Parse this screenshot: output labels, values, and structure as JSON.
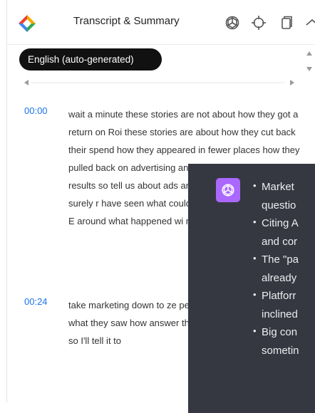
{
  "header": {
    "title": "Transcript & Summary",
    "icons": [
      "chatgpt-icon",
      "crosshair-icon",
      "copy-icon",
      "chevron-up-icon"
    ]
  },
  "language": {
    "selected": "English (auto-generated)"
  },
  "transcript": [
    {
      "time": "00:00",
      "text": "wait a minute these stories are not about how they got a return on Roi these stories are about how they cut back their spend how they appeared in fewer places how they pulled back on advertising and saw the same or better results so tell us about ads are they these are ads that surely r have seen what could be g theory it's very similar to E around what happened wi right we can"
    },
    {
      "time": "00:24",
      "text": "take marketing down to ze percent of the same traffi exactly what they saw how answer this with a story it the pizzeria so I'll tell it to"
    }
  ],
  "summary": {
    "bullets": [
      [
        "Market",
        "questio"
      ],
      [
        "Citing A",
        "and cor"
      ],
      [
        "The \"pa",
        "already"
      ],
      [
        "Platforr",
        "inclined"
      ],
      [
        "Big con",
        "sometin"
      ]
    ]
  },
  "colors": {
    "accent": "#1a73e8",
    "overlay": "#363841",
    "gpt": "#ab68ff"
  }
}
